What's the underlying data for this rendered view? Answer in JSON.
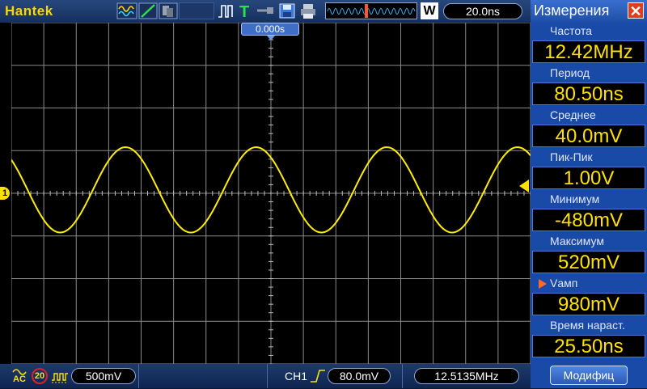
{
  "header": {
    "brand": "Hantek",
    "window_label": "W",
    "timebase": "20.0ns"
  },
  "scope": {
    "trigger_time": "0.000s",
    "channel_marker": "1",
    "trace_color": "#ffee00",
    "grid_color": "#8a8a8a"
  },
  "status": {
    "coupling": "AC",
    "bw_limit": "20",
    "ch1_scale": "500mV",
    "trigger_source": "CH1",
    "trigger_level": "80.0mV",
    "frequency": "12.5135MHz"
  },
  "panel": {
    "title": "Измерения",
    "close_glyph": "✕",
    "measurements": [
      {
        "label": "Частота",
        "value": "12.42MHz",
        "selected": false
      },
      {
        "label": "Период",
        "value": "80.50ns",
        "selected": false
      },
      {
        "label": "Среднее",
        "value": "40.0mV",
        "selected": false
      },
      {
        "label": "Пик-Пик",
        "value": "1.00V",
        "selected": false
      },
      {
        "label": "Минимум",
        "value": "-480mV",
        "selected": false
      },
      {
        "label": "Максимум",
        "value": "520mV",
        "selected": false
      },
      {
        "label": "Vамп",
        "value": "980mV",
        "selected": true
      },
      {
        "label": "Время нараст.",
        "value": "25.50ns",
        "selected": false
      }
    ],
    "modify_label": "Модифиц"
  },
  "icons": [
    "wave-icon",
    "ramp-icon",
    "persist-icon",
    "pulse-icon",
    "trigger-t-icon",
    "probe-icon",
    "save-icon",
    "print-icon",
    "memory-overview-icon"
  ]
}
